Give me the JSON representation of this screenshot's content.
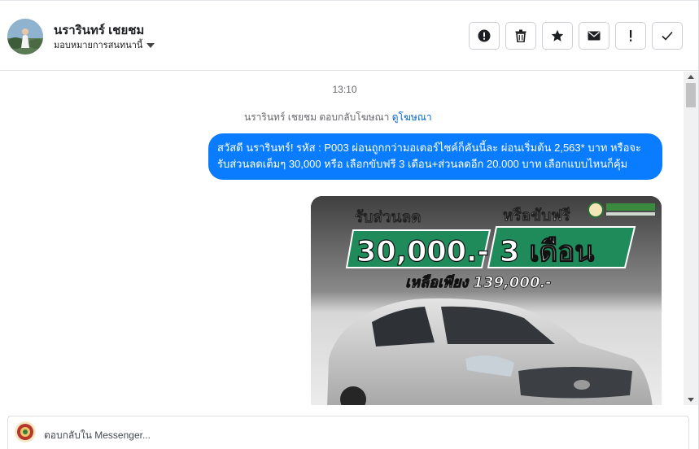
{
  "header": {
    "contact_name": "นรารินทร์ เชยชม",
    "assign_label": "มอบหมายการสนทนานี้",
    "toolbar": [
      {
        "name": "spam-alert-icon"
      },
      {
        "name": "trash-icon"
      },
      {
        "name": "star-icon"
      },
      {
        "name": "envelope-icon"
      },
      {
        "name": "exclamation-icon"
      },
      {
        "name": "checkmark-icon"
      }
    ]
  },
  "conversation": {
    "timestamp": "13:10",
    "reply_note_prefix": "นรารินทร์ เชยชม ตอบกลับโฆษณา",
    "reply_note_link": "ดูโฆษณา",
    "message": "สวัสดี นรารินทร์! รหัส : P003 ผ่อนถูกกว่ามอเตอร์ไซค์ก็คันนี้ละ ผ่อนเริ่มต้น 2,563* บาท หรือจะรับส่วนลดเต็มๆ 30,000 หรือ เลือกขับฟรี 3 เดือน+ส่วนลดอีก 20.000 บาท เลือกแบบไหนก็คุ้ม",
    "bubble_color": "#0a7cff",
    "ad_image": {
      "headline_left": "รับส่วนลด",
      "headline_right": "หรือขับฟรี",
      "discount": "30,000.-",
      "free_months": "3 เดือน",
      "price": "เหลือเพียง 139,000.-",
      "accent": "#1f8a5a"
    }
  },
  "composer": {
    "placeholder": "ตอบกลับใน Messenger..."
  }
}
